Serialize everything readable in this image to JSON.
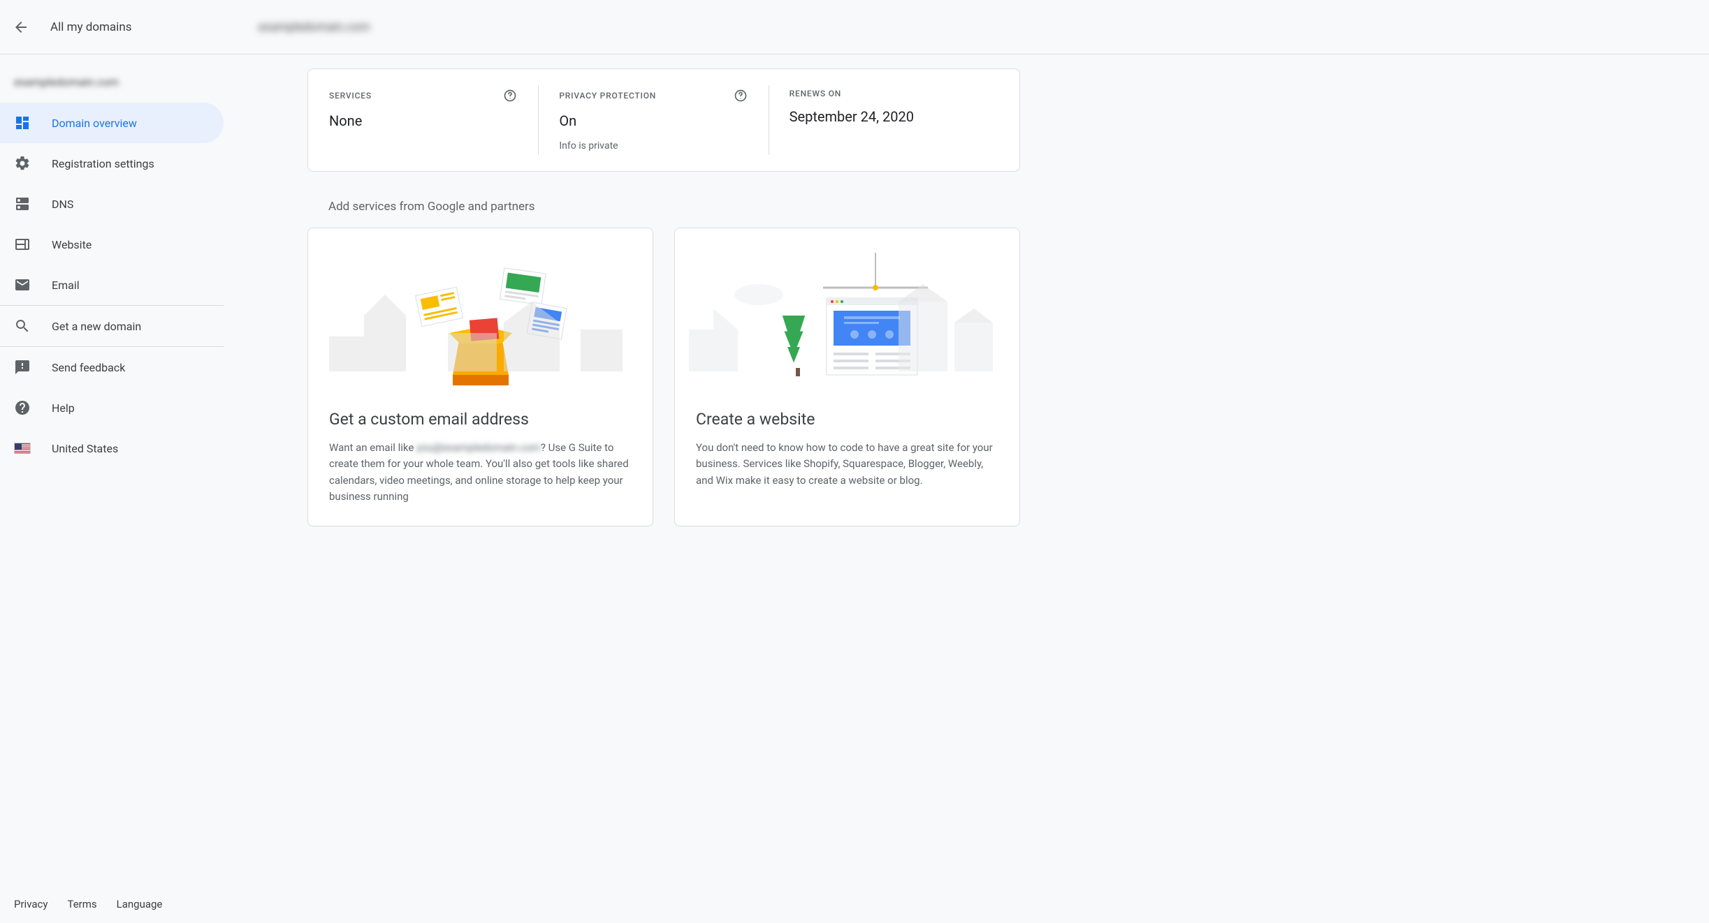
{
  "header": {
    "back_label": "Back",
    "title": "All my domains",
    "domain_name": "exampledomain.com"
  },
  "sidebar": {
    "domain_name": "exampledomain.com",
    "items": [
      {
        "label": "Domain overview",
        "icon": "dashboard",
        "active": true
      },
      {
        "label": "Registration settings",
        "icon": "settings",
        "active": false
      },
      {
        "label": "DNS",
        "icon": "dns",
        "active": false
      },
      {
        "label": "Website",
        "icon": "web",
        "active": false
      },
      {
        "label": "Email",
        "icon": "email",
        "active": false
      }
    ],
    "get_domain_label": "Get a new domain",
    "feedback_label": "Send feedback",
    "help_label": "Help",
    "country_label": "United States"
  },
  "footer": {
    "privacy": "Privacy",
    "terms": "Terms",
    "language": "Language"
  },
  "summary": {
    "services": {
      "label": "SERVICES",
      "value": "None"
    },
    "privacy": {
      "label": "PRIVACY PROTECTION",
      "value": "On",
      "sub": "Info is private"
    },
    "renews": {
      "label": "RENEWS ON",
      "value": "September 24, 2020"
    }
  },
  "section_title": "Add services from Google and partners",
  "cards": {
    "email": {
      "title": "Get a custom email address",
      "desc_prefix": "Want an email like ",
      "desc_blur": "you@exampledomain.com",
      "desc_suffix": "? Use G Suite to create them for your whole team. You'll also get tools like shared calendars, video meetings, and online storage to help keep your business running"
    },
    "website": {
      "title": "Create a website",
      "desc": "You don't need to know how to code to have a great site for your business. Services like Shopify, Squarespace, Blogger, Weebly, and Wix make it easy to create a website or blog."
    }
  }
}
